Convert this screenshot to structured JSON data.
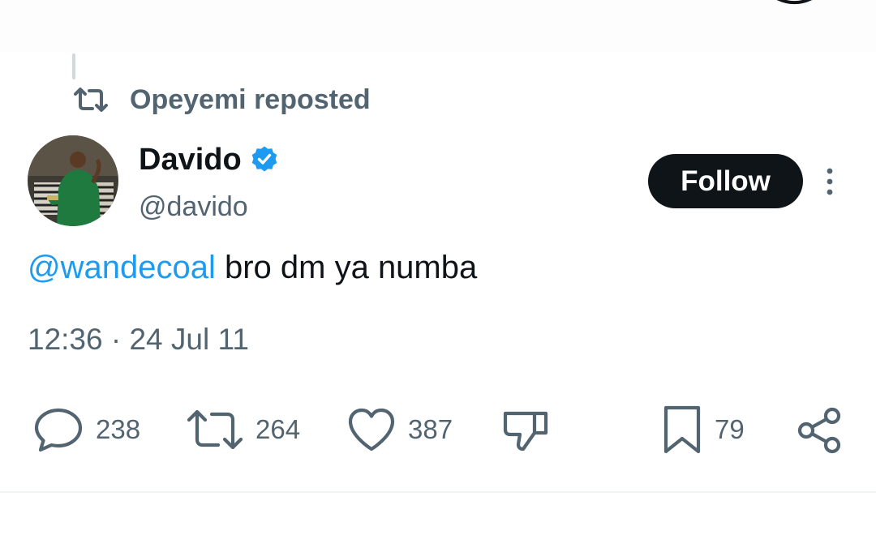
{
  "repost": {
    "label": "Opeyemi reposted"
  },
  "author": {
    "name": "Davido",
    "handle": "@davido",
    "verified": true,
    "avatar_icon": "profile-photo"
  },
  "follow": {
    "label": "Follow"
  },
  "tweet": {
    "mention": "@wandecoal",
    "body": " bro dm ya numba"
  },
  "meta": {
    "time": "12:36",
    "separator": " · ",
    "date": "24 Jul 11"
  },
  "actions": {
    "replies": "238",
    "reposts": "264",
    "likes": "387",
    "bookmarks": "79"
  },
  "colors": {
    "accent": "#1d9bf0",
    "text": "#0f1419",
    "muted": "#536471",
    "follow_bg": "#0f1419"
  }
}
